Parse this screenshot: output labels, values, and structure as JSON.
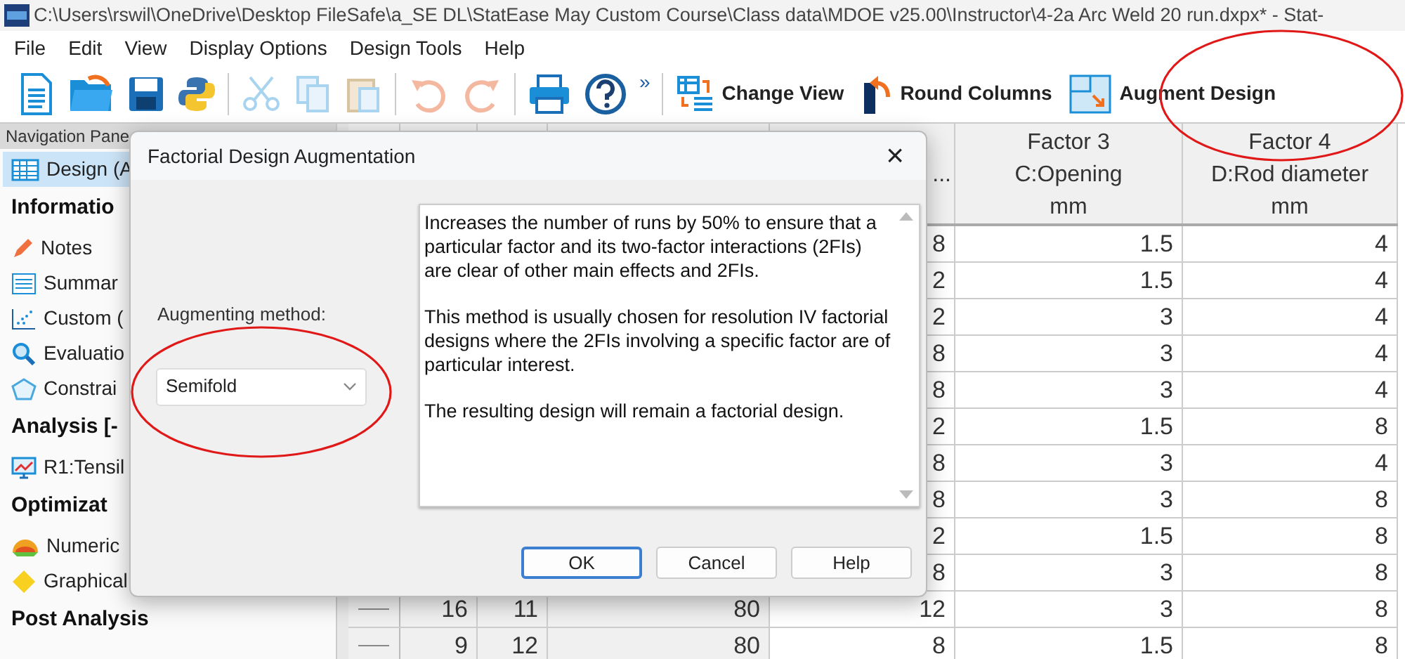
{
  "window": {
    "title": "C:\\Users\\rswil\\OneDrive\\Desktop FileSafe\\a_SE DL\\StatEase May Custom Course\\Class data\\MDOE v25.00\\Instructor\\4-2a Arc Weld 20 run.dxpx* - Stat-"
  },
  "menu": [
    "File",
    "Edit",
    "View",
    "Display Options",
    "Design Tools",
    "Help"
  ],
  "toolbar": {
    "more": "»",
    "buttons": [
      {
        "label": "Change View"
      },
      {
        "label": "Round Columns"
      },
      {
        "label": "Augment Design"
      }
    ]
  },
  "navigation": {
    "title": "Navigation Pane",
    "items": [
      {
        "kind": "item",
        "label": "Design (A",
        "selected": true
      },
      {
        "kind": "heading",
        "label": "Informatio"
      },
      {
        "kind": "item",
        "label": "Notes",
        "selected": false
      },
      {
        "kind": "item",
        "label": "Summar",
        "selected": false
      },
      {
        "kind": "item",
        "label": "Custom (",
        "selected": false
      },
      {
        "kind": "item",
        "label": "Evaluatio",
        "selected": false
      },
      {
        "kind": "item",
        "label": "Constrai",
        "selected": false
      },
      {
        "kind": "heading",
        "label": "Analysis [-"
      },
      {
        "kind": "item",
        "label": "R1:Tensil",
        "selected": false
      },
      {
        "kind": "heading",
        "label": "Optimizat"
      },
      {
        "kind": "item",
        "label": "Numeric",
        "selected": false
      },
      {
        "kind": "item",
        "label": "Graphical",
        "selected": false
      },
      {
        "kind": "heading",
        "label": "Post Analysis"
      }
    ]
  },
  "grid": {
    "columns": [
      {
        "lines": [
          "..."
        ]
      },
      {
        "lines": [
          "Factor 3",
          "C:Opening",
          "mm"
        ]
      },
      {
        "lines": [
          "Factor 4",
          "D:Rod diameter",
          "mm"
        ]
      }
    ],
    "rows": [
      {
        "cells": [
          "8",
          "1.5",
          "4"
        ]
      },
      {
        "cells": [
          "2",
          "1.5",
          "4"
        ]
      },
      {
        "cells": [
          "2",
          "3",
          "4"
        ]
      },
      {
        "cells": [
          "8",
          "3",
          "4"
        ]
      },
      {
        "cells": [
          "8",
          "3",
          "4"
        ]
      },
      {
        "cells": [
          "2",
          "1.5",
          "8"
        ]
      },
      {
        "cells": [
          "8",
          "3",
          "4"
        ]
      },
      {
        "cells": [
          "8",
          "3",
          "8"
        ]
      },
      {
        "cells": [
          "2",
          "1.5",
          "8"
        ]
      },
      {
        "cells": [
          "8",
          "3",
          "8"
        ]
      },
      {
        "cells": [
          "16",
          "11",
          "80",
          "12",
          "3",
          "8"
        ]
      },
      {
        "cells": [
          "9",
          "12",
          "80",
          "8",
          "1.5",
          "8"
        ]
      }
    ]
  },
  "dialog": {
    "title": "Factorial Design Augmentation",
    "close": "×",
    "method_label": "Augmenting method:",
    "method": "Semifold",
    "description": [
      "Increases the number of runs by 50% to ensure that a particular factor and its two-factor interactions (2FIs) are clear of other main effects and 2FIs.",
      "This method is usually chosen for resolution IV factorial designs where the 2FIs involving a specific factor are of particular interest.",
      "The resulting design will remain a factorial design."
    ],
    "buttons": [
      {
        "label": "OK",
        "default": true
      },
      {
        "label": "Cancel",
        "default": false
      },
      {
        "label": "Help",
        "default": false
      }
    ]
  },
  "annotations": [
    {
      "kind": "ellipse"
    },
    {
      "kind": "ellipse"
    }
  ]
}
